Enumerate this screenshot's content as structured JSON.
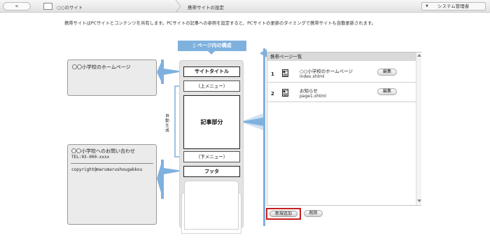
{
  "topbar": {
    "back_label": "«",
    "site_name": "○○のサイト",
    "page_title": "携帯サイトの設定",
    "user_menu_label": "システム管理者",
    "user_menu_chevron": "▼"
  },
  "description": "携帯サイトはPCサイトとコンテンツを共有します。PCサイトの記事への参照を設定すると、PCサイトの更新のタイミングで携帯サイトも自動更新されます。",
  "preview": {
    "header": "ページ内の構成",
    "slots": {
      "title": "サイトタイトル",
      "top_menu": "（上メニュー）",
      "article": "記事部分",
      "bottom_menu": "（下メニュー）",
      "footer": "フッタ"
    },
    "auto_label": "自動生成"
  },
  "info_boxes": {
    "home": "〇〇小学校のホームページ",
    "footer_line1": "〇〇小学校へのお問い合わせ",
    "footer_line2": "TEL:03-000-xxxx",
    "footer_line3": "copyright@marumarushougakkou"
  },
  "list": {
    "header": "携帯ページ一覧",
    "rows": [
      {
        "num": "1",
        "name": "○○小学校のホームページ",
        "file": "index.xhtml",
        "edit": "編集"
      },
      {
        "num": "2",
        "name": "お知らせ",
        "file": "page1.xhtml",
        "edit": "編集"
      }
    ]
  },
  "actions": {
    "add": "新規追加",
    "delete": "削除"
  },
  "colors": {
    "accent_blue": "#7fb1de",
    "highlight_red": "#c81e1e"
  }
}
